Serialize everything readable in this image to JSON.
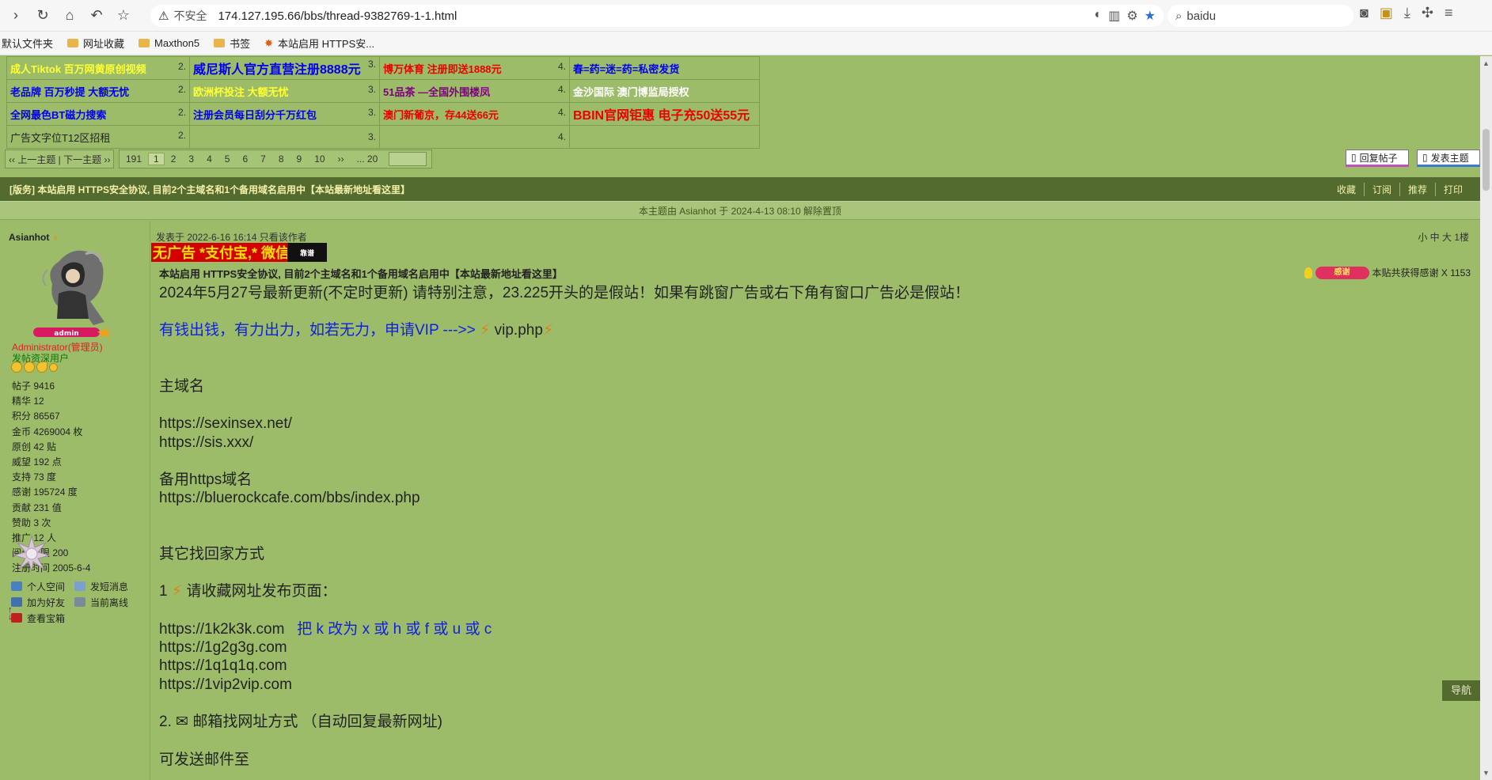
{
  "browser": {
    "security_label": "不安全",
    "url": "174.127.195.66/bbs/thread-9382769-1-1.html",
    "search_value": "baidu"
  },
  "bookmarks": [
    {
      "label": "默认文件夹"
    },
    {
      "label": "网址收藏"
    },
    {
      "label": "Maxthon5"
    },
    {
      "label": "书签"
    },
    {
      "label": "本站启用 HTTPS安..."
    }
  ],
  "ads": {
    "rows": [
      [
        {
          "text": "成人Tiktok 百万网黄原创视频",
          "num": "2.",
          "cls": "ad-yellow"
        },
        {
          "text": "威尼斯人官方直营注册8888元",
          "num": "3.",
          "cls": "ad-blue big"
        },
        {
          "text": "博万体育 注册即送1888元",
          "num": "4.",
          "cls": "ad-red"
        },
        {
          "text": "春=药=迷=药=私密发货",
          "num": "",
          "cls": "ad-blue"
        }
      ],
      [
        {
          "text": "老品牌 百万秒提 大额无忧",
          "num": "2.",
          "cls": "ad-blue"
        },
        {
          "text": "欧洲杯投注 大额无忧",
          "num": "3.",
          "cls": "ad-yellow"
        },
        {
          "text": "51品茶 —全国外围楼凤",
          "num": "4.",
          "cls": "ad-purple"
        },
        {
          "text": "金沙国际 澳门博监局授权",
          "num": "",
          "cls": "ad-white"
        }
      ],
      [
        {
          "text": "全网最色BT磁力搜索",
          "num": "2.",
          "cls": "ad-blue"
        },
        {
          "text": "注册会员每日刮分千万红包",
          "num": "3.",
          "cls": "ad-blue"
        },
        {
          "text": "澳门新葡京，存44送66元",
          "num": "4.",
          "cls": "ad-red"
        },
        {
          "text": "BBIN官网钜惠 电子充50送55元",
          "num": "",
          "cls": "ad-red big"
        }
      ],
      [
        {
          "text": "广告文字位T12区招租",
          "num": "2.",
          "cls": "ad-dark"
        },
        {
          "text": "",
          "num": "3.",
          "cls": ""
        },
        {
          "text": "",
          "num": "4.",
          "cls": ""
        },
        {
          "text": "",
          "num": "",
          "cls": ""
        }
      ]
    ]
  },
  "pager": {
    "prev_next": "‹‹ 上一主题 | 下一主题 ››",
    "total": "191",
    "pages": [
      "1",
      "2",
      "3",
      "4",
      "5",
      "6",
      "7",
      "8",
      "9",
      "10"
    ],
    "next": "››",
    "last": "... 20",
    "reply_label": "回复帖子",
    "new_label": "发表主题"
  },
  "notice": {
    "text": "[版务] 本站启用 HTTPS安全协议, 目前2个主域名和1个备用域名启用中【本站最新地址看这里】",
    "links": [
      "收藏",
      "订阅",
      "推荐",
      "打印"
    ]
  },
  "pinned": "本主题由 Asianhot 于 2024-4-13 08:10 解除置顶",
  "author": {
    "name": "Asianhot",
    "badge": "admin",
    "role": "Administrator(管理员)",
    "role2": "发帖资深用户",
    "stats": [
      "帖子 9416",
      "精华 12",
      "积分 86567",
      "金币 4269004 枚",
      "原创 42 贴",
      "威望 192 点",
      "支持 73 度",
      "感谢 195724 度",
      "贡献 231 值",
      "赞助 3 次",
      "推广 12 人",
      "阅读权限 200",
      "注册时间 2005-6-4"
    ],
    "links": [
      "个人空间",
      "发短消息",
      "加为好友",
      "当前离线",
      "查看宝箱"
    ]
  },
  "post": {
    "meta": "发表于 2022-6-16 16:14  只看该作者",
    "size_floor": "小 中 大  1楼",
    "banner_text": "无广告 *支付宝,* 微信",
    "banner_block": "靠谱",
    "title": "本站启用 HTTPS安全协议, 目前2个主域名和1个备用域名启用中【本站最新地址看这里】",
    "thanks_badge": "感谢",
    "thanks_text": "本贴共获得感谢 X 1153",
    "line1": "2024年5月27号最新更新(不定时更新) 请特别注意，23.225开头的是假站！如果有跳窗广告或右下角有窗口广告必是假站！",
    "vip_text": "有钱出钱，有力出力，如若无力，申请VIP --->>",
    "vip_link": "vip.php",
    "main_domain_label": "主域名",
    "domain1": "https://sexinsex.net/",
    "domain2": "https://sis.xxx/",
    "backup_label": "备用https域名",
    "backup1": "https://bluerockcafe.com/bbs/index.php",
    "other_label": "其它找回家方式",
    "step1_num": "1",
    "step1": "请收藏网址发布页面：",
    "site1": "https://1k2k3k.com",
    "site1_note": "把 k 改为 x 或 h 或 f 或 u 或 c",
    "site2": "https://1g2g3g.com",
    "site3": "https://1q1q1q.com",
    "site4": "https://1vip2vip.com",
    "step2_num": "2.",
    "step2": "邮箱找网址方式 （自动回复最新网址)",
    "mail_label": "可发送邮件至"
  },
  "nav_label": "导航"
}
